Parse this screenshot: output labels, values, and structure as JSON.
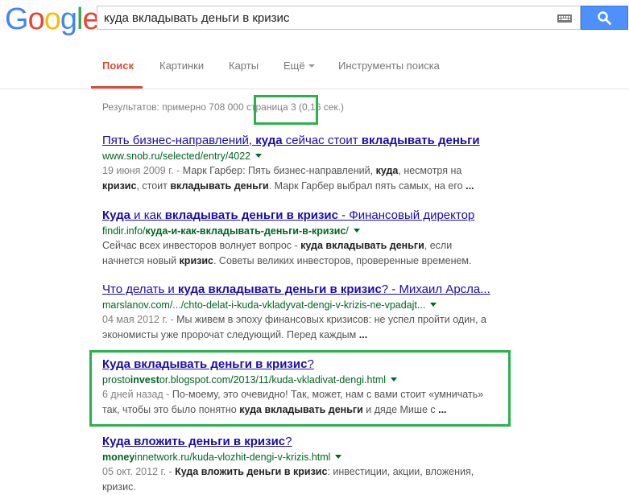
{
  "logo": {
    "letters": [
      "G",
      "o",
      "o",
      "g",
      "l",
      "e"
    ],
    "colors": [
      "#4285f4",
      "#ea4335",
      "#fbbc05",
      "#4285f4",
      "#34a853",
      "#ea4335"
    ]
  },
  "search": {
    "query": "куда вкладывать деньги в кризис",
    "keyboard_icon": "keyboard-icon",
    "button_icon": "search-icon"
  },
  "nav": {
    "search": "Поиск",
    "images": "Картинки",
    "maps": "Карты",
    "more": "Ещё",
    "tools": "Инструменты поиска"
  },
  "stats": {
    "prefix": "Результатов: примерно 708 000 ",
    "page": "страница 3",
    "suffix": " (0,16 сек.)"
  },
  "colors": {
    "accent": "#dd4b39",
    "link": "#1a0dab",
    "url": "#006621",
    "highlight": "#2bb24c",
    "button": "#4d90fe"
  },
  "results": [
    {
      "title": [
        {
          "t": "Пять бизнес-направлений, ",
          "b": false
        },
        {
          "t": "куда",
          "b": true
        },
        {
          "t": " сейчас стоит ",
          "b": false
        },
        {
          "t": "вкладывать деньги",
          "b": true
        }
      ],
      "url": [
        {
          "t": "www.snob.ru/selected/entry/4022",
          "b": false
        }
      ],
      "snippet": [
        [
          {
            "t": "19 июня 2009 г. - ",
            "b": false,
            "d": true
          },
          {
            "t": "Марк Гарбер: Пять бизнес-направлений, ",
            "b": false
          },
          {
            "t": "куда",
            "b": true
          },
          {
            "t": ", несмотря на",
            "b": false
          }
        ],
        [
          {
            "t": "кризис",
            "b": true
          },
          {
            "t": ", стоит ",
            "b": false
          },
          {
            "t": "вкладывать деньги",
            "b": true
          },
          {
            "t": ". Марк Гарбер выбрал пять самых, на его ",
            "b": false
          },
          {
            "t": "...",
            "b": true
          }
        ]
      ]
    },
    {
      "title": [
        {
          "t": "Куда",
          "b": true
        },
        {
          "t": " и как ",
          "b": false
        },
        {
          "t": "вкладывать деньги в кризис",
          "b": true
        },
        {
          "t": " - Финансовый директор",
          "b": false
        }
      ],
      "url": [
        {
          "t": "findir.info/",
          "b": false
        },
        {
          "t": "куда-и-как-вкладывать-деньги-в-кризис",
          "b": true
        },
        {
          "t": "/",
          "b": false
        }
      ],
      "snippet": [
        [
          {
            "t": "Сейчас всех инвесторов волнует вопрос - ",
            "b": false
          },
          {
            "t": "куда вкладывать деньги",
            "b": true
          },
          {
            "t": ", если",
            "b": false
          }
        ],
        [
          {
            "t": "начнется новый ",
            "b": false
          },
          {
            "t": "кризис",
            "b": true
          },
          {
            "t": ". Советы великих инвесторов, проверенные временем.",
            "b": false
          }
        ]
      ]
    },
    {
      "title": [
        {
          "t": "Что делать и ",
          "b": false
        },
        {
          "t": "куда вкладывать деньги в кризис",
          "b": true
        },
        {
          "t": "? - Михаил Арсла...",
          "b": false
        }
      ],
      "url": [
        {
          "t": "marslanov.com/.../chto-delat-i-kuda-vkladyvat-dengi-v-krizis-ne-vpadajt...",
          "b": false
        }
      ],
      "snippet": [
        [
          {
            "t": "04 мая 2012 г. - ",
            "b": false,
            "d": true
          },
          {
            "t": "Мы живем в эпоху финансовых кризисов: не успел пройти один, а",
            "b": false
          }
        ],
        [
          {
            "t": "экономисты уже пророчат следующий. Перед каждым ",
            "b": false
          },
          {
            "t": "...",
            "b": true
          }
        ]
      ]
    },
    {
      "title": [
        {
          "t": "Куда вкладывать деньги в кризис",
          "b": true
        },
        {
          "t": "?",
          "b": false
        }
      ],
      "url": [
        {
          "t": "prosto",
          "b": false
        },
        {
          "t": "invest",
          "b": true
        },
        {
          "t": "or.blogspot.com/2013/11/kuda-vkladivat-dengi.html",
          "b": false
        }
      ],
      "snippet": [
        [
          {
            "t": "6 дней назад - ",
            "b": false,
            "d": true
          },
          {
            "t": "По-моему, это очевидно! Так, может, нам с вами стоит «умничать»",
            "b": false
          }
        ],
        [
          {
            "t": "так, чтобы это было понятно ",
            "b": false
          },
          {
            "t": "куда вкладывать деньги",
            "b": true
          },
          {
            "t": " и дяде Мише с ",
            "b": false
          },
          {
            "t": "...",
            "b": true
          }
        ]
      ]
    },
    {
      "title": [
        {
          "t": "Куда вложить деньги в кризис",
          "b": true
        },
        {
          "t": "?",
          "b": false
        }
      ],
      "url": [
        {
          "t": "money",
          "b": true
        },
        {
          "t": "innetwork.ru/kuda-vlozhit-dengi-v-krizis.html",
          "b": false
        }
      ],
      "snippet": [
        [
          {
            "t": "05 окт. 2012 г. - ",
            "b": false,
            "d": true
          },
          {
            "t": "Куда вложить деньги в кризис",
            "b": true
          },
          {
            "t": ": инвестиции, акции, вложения,",
            "b": false
          }
        ],
        [
          {
            "t": "кризис.",
            "b": false
          }
        ]
      ]
    }
  ]
}
